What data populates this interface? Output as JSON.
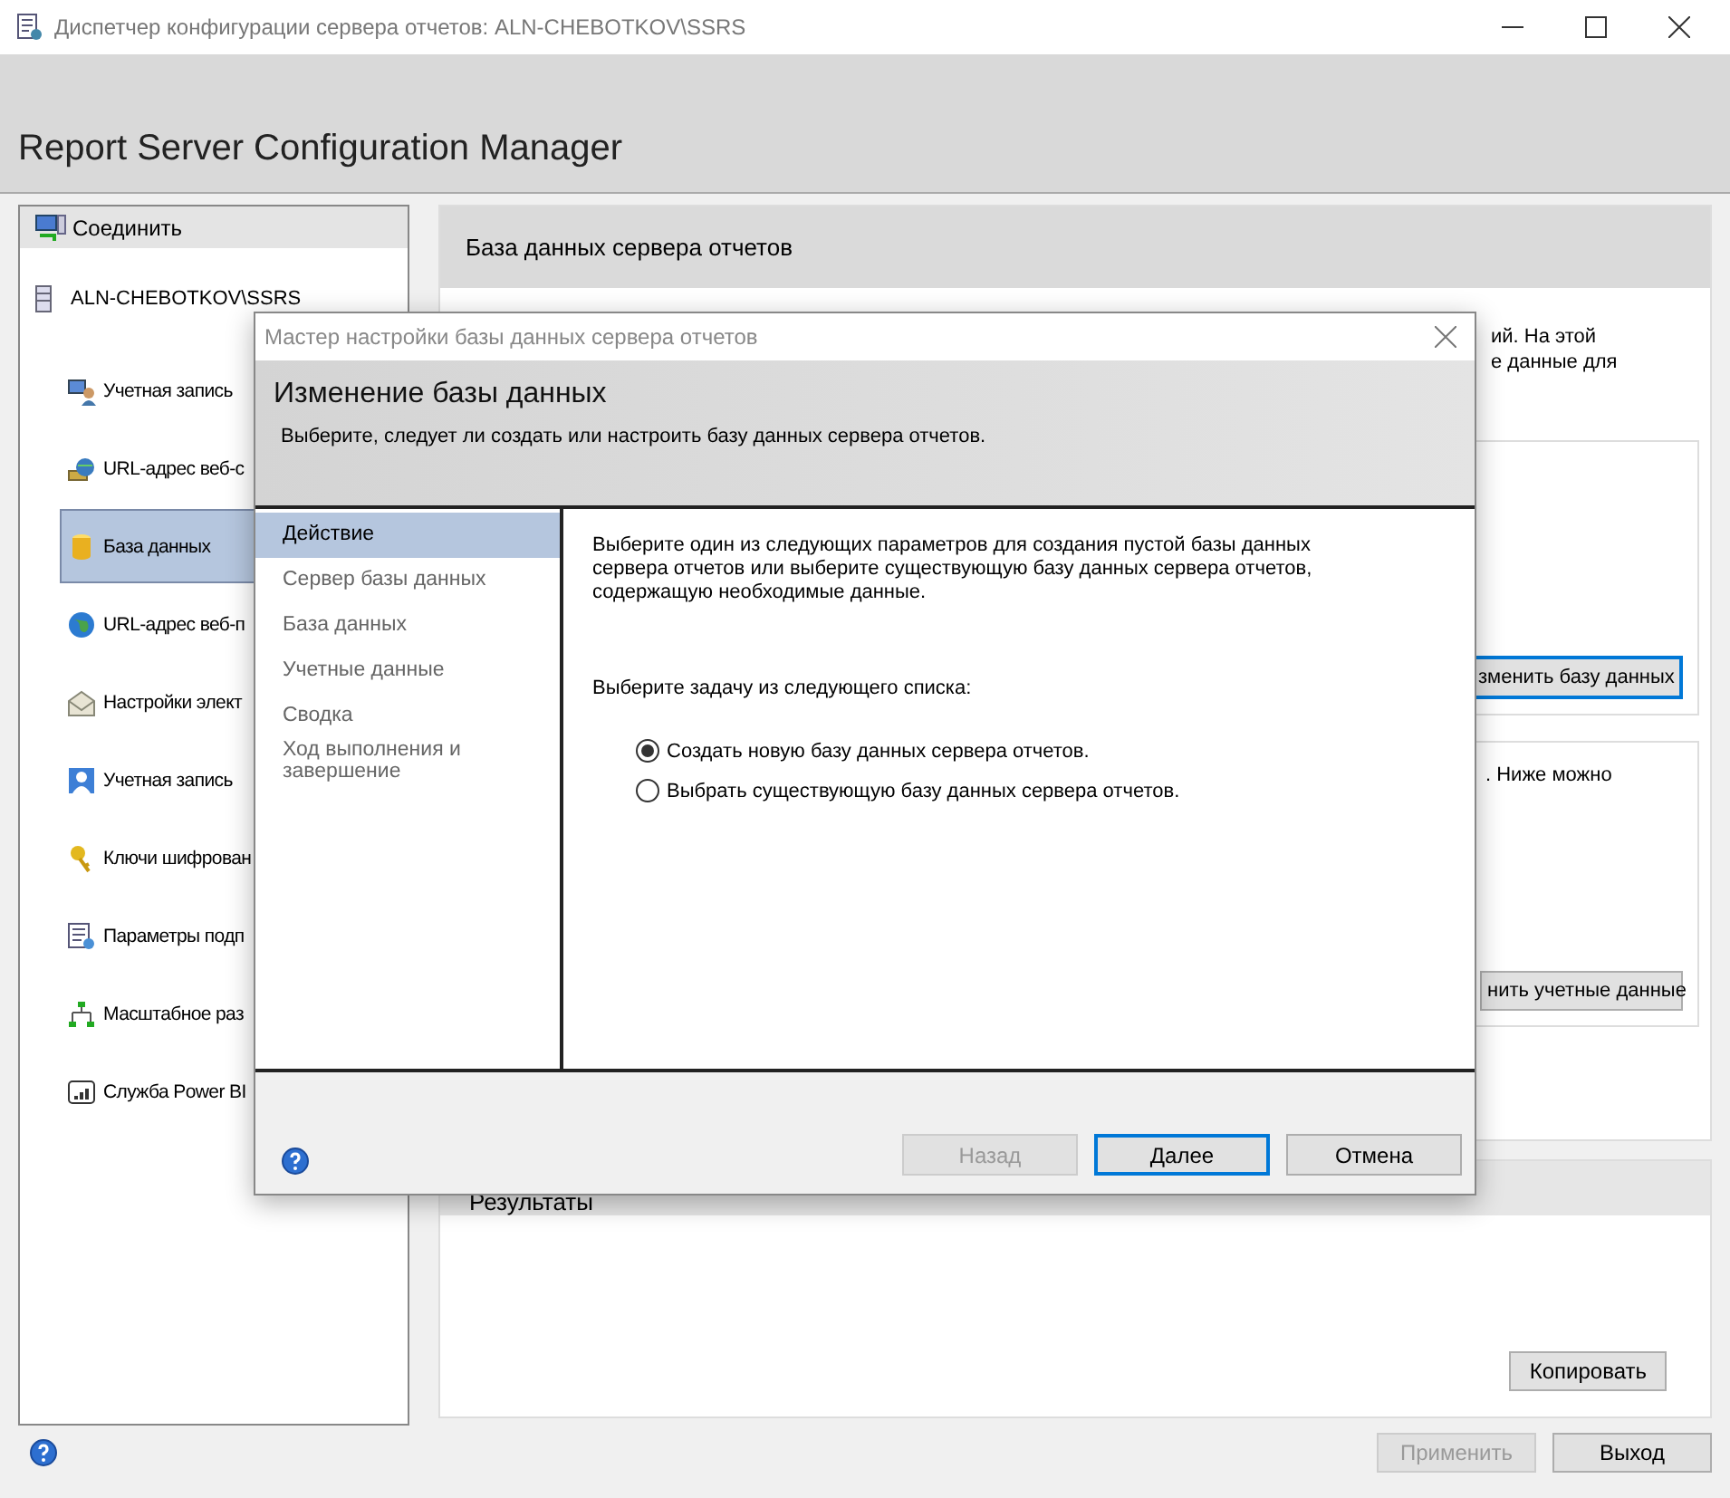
{
  "window": {
    "title": "Диспетчер конфигурации сервера отчетов: ALN-CHEBOTKOV\\SSRS"
  },
  "app_title": "Report Server Configuration Manager",
  "sidebar": {
    "connect": "Соединить",
    "server": "ALN-CHEBOTKOV\\SSRS",
    "items": [
      {
        "label": "Учетная запись",
        "selected": false
      },
      {
        "label": "URL-адрес веб-с",
        "selected": false
      },
      {
        "label": "База данных",
        "selected": true
      },
      {
        "label": "URL-адрес веб-п",
        "selected": false
      },
      {
        "label": "Настройки элект",
        "selected": false
      },
      {
        "label": "Учетная запись",
        "selected": false
      },
      {
        "label": "Ключи шифрован",
        "selected": false
      },
      {
        "label": "Параметры подп",
        "selected": false
      },
      {
        "label": "Масштабное раз",
        "selected": false
      },
      {
        "label": "Служба Power BI",
        "selected": false
      }
    ]
  },
  "main_panel": {
    "title": "База данных сервера отчетов",
    "intro_lines": [
      "ий. На этой",
      "е данные для"
    ],
    "change_button": "зменить базу данных",
    "credentials_text": ". Ниже можно",
    "credentials_button": "нить учетные данные"
  },
  "results": {
    "title": "Результаты",
    "copy_button": "Копировать"
  },
  "footer_buttons": [
    {
      "label": "Применить",
      "disabled": true
    },
    {
      "label": "Выход",
      "disabled": false
    }
  ],
  "dialog": {
    "title": "Мастер настройки базы данных сервера отчетов",
    "heading": "Изменение базы данных",
    "subheading": "Выберите, следует ли создать или настроить базу данных сервера отчетов.",
    "steps": [
      {
        "label": "Действие",
        "selected": true
      },
      {
        "label": "Сервер базы данных",
        "selected": false
      },
      {
        "label": "База данных",
        "selected": false
      },
      {
        "label": "Учетные данные",
        "selected": false
      },
      {
        "label": "Сводка",
        "selected": false
      },
      {
        "label": "Ход выполнения и завершение",
        "selected": false
      }
    ],
    "description": "Выберите один из следующих параметров для создания пустой базы данных сервера отчетов или выберите существующую базу данных сервера отчетов, содержащую необходимые данные.",
    "prompt": "Выберите задачу из следующего списка:",
    "options": [
      {
        "label": "Создать новую базу данных сервера отчетов.",
        "selected": true
      },
      {
        "label": "Выбрать существующую базу данных сервера отчетов.",
        "selected": false
      }
    ],
    "buttons": [
      {
        "label": "Назад",
        "disabled": true,
        "default": false
      },
      {
        "label": "Далее",
        "disabled": false,
        "default": true
      },
      {
        "label": "Отмена",
        "disabled": false,
        "default": false
      }
    ]
  }
}
